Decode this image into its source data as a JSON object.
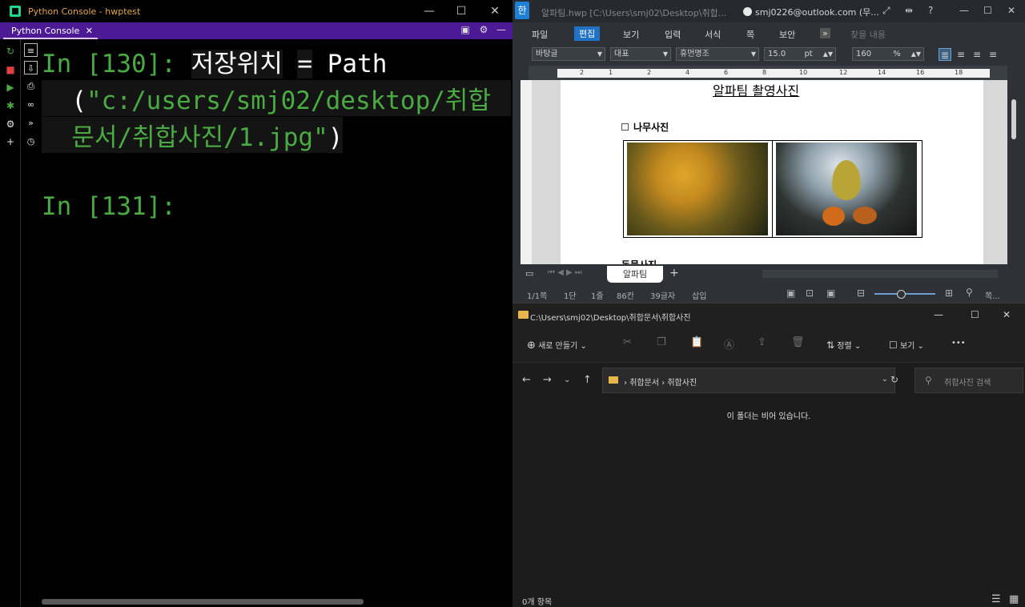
{
  "pycharm": {
    "title": "Python Console - hwptest",
    "tab_label": "Python Console",
    "tab_close": "✕",
    "prompt1": "In [130]:",
    "code_var": "저장위치",
    "code_eq": "=",
    "code_func": "Path",
    "code_paren_open": "(",
    "code_string_1": "\"c:/users/smj02/desktop/취합",
    "code_string_2": "문서/취합사진/1.jpg\"",
    "code_paren_close": ")",
    "prompt2": "In [131]:"
  },
  "hancom": {
    "title": "알파팀.hwp [C:\\Users\\smj02\\Desktop\\취합...",
    "account": "smj0226@outlook.com (무...",
    "menu": [
      "파일",
      "편집",
      "보기",
      "입력",
      "서식",
      "쪽",
      "보안"
    ],
    "search_placeholder": "찾을 내용",
    "style_box": "바탕글",
    "lang_box": "대표",
    "font_box": "휴먼명조",
    "size_box": "15.0",
    "size_unit": "pt",
    "zoom_box": "160",
    "zoom_unit": "%",
    "ruler_numbers": [
      "2",
      "1",
      "2",
      "4",
      "6",
      "8",
      "10",
      "12",
      "14",
      "16",
      "18"
    ],
    "doc_heading": "알파팀 촬영사진",
    "doc_subheading": "나무사진",
    "doc_next": "동물사진",
    "sheet_tab": "알파팀",
    "status": {
      "page": "1/1쪽",
      "section": "1단",
      "line": "1줄",
      "column": "86칸",
      "chars": "39글자",
      "mode": "삽입",
      "zoom_label": "쪽..."
    }
  },
  "explorer": {
    "title": "C:\\Users\\smj02\\Desktop\\취합문서\\취합사진",
    "new_button": "새로 만들기",
    "sort_button": "정렬",
    "view_button": "보기",
    "more_button": "•••",
    "breadcrumb_1": "취합문서",
    "breadcrumb_2": "취합사진",
    "search_placeholder": "취합사진 검색",
    "empty_message": "이 폴더는 비어 있습니다.",
    "status": "0개 항목"
  },
  "colors": {
    "pycharm_green": "#4aab42",
    "pycharm_tab_purple": "#4c1a94",
    "hancom_accent": "#1f72c4",
    "folder_yellow": "#e8b64a"
  }
}
